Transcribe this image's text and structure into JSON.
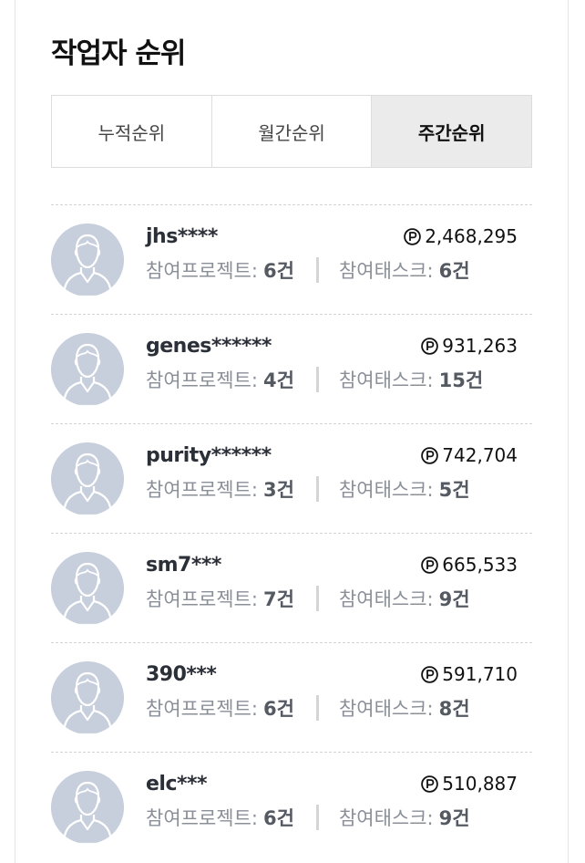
{
  "title": "작업자 순위",
  "tabs": [
    {
      "label": "누적순위",
      "active": false
    },
    {
      "label": "월간순위",
      "active": false
    },
    {
      "label": "주간순위",
      "active": true
    }
  ],
  "labels": {
    "projects": "참여프로젝트:",
    "tasks": "참여태스크:"
  },
  "workers": [
    {
      "name": "jhs****",
      "points": "2,468,295",
      "projects": "6건",
      "tasks": "6건"
    },
    {
      "name": "genes******",
      "points": "931,263",
      "projects": "4건",
      "tasks": "15건"
    },
    {
      "name": "purity******",
      "points": "742,704",
      "projects": "3건",
      "tasks": "5건"
    },
    {
      "name": "sm7***",
      "points": "665,533",
      "projects": "7건",
      "tasks": "9건"
    },
    {
      "name": "390***",
      "points": "591,710",
      "projects": "6건",
      "tasks": "8건"
    },
    {
      "name": "elc***",
      "points": "510,887",
      "projects": "6건",
      "tasks": "9건"
    }
  ],
  "icons": {
    "avatar": "default-user-avatar-icon",
    "points": "point-coin-icon"
  },
  "colors": {
    "active_tab_bg": "#ebebeb",
    "avatar_bg": "#c7cfdd"
  }
}
